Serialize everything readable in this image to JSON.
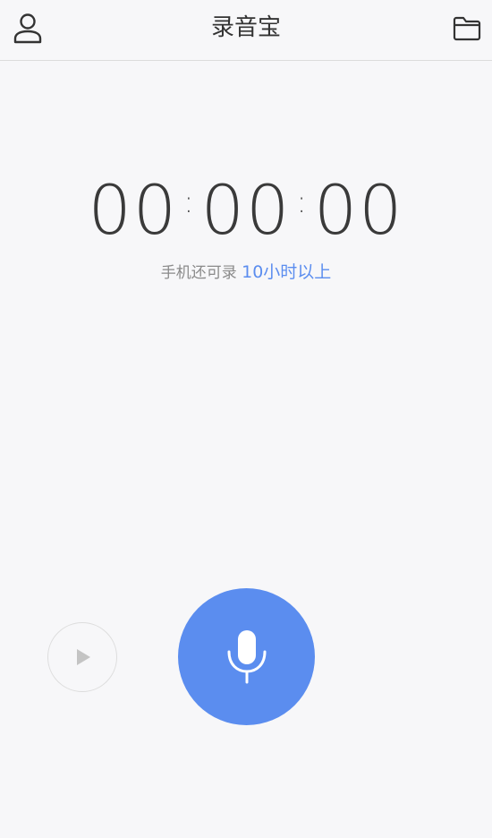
{
  "header": {
    "title": "录音宝",
    "left_icon": "user-icon",
    "right_icon": "folder-icon"
  },
  "timer": {
    "hours": "00",
    "minutes": "00",
    "seconds": "00",
    "separator": ":"
  },
  "storage": {
    "prefix": "手机还可录 ",
    "remaining": "10小时以上"
  },
  "controls": {
    "play_icon": "play-icon",
    "record_icon": "microphone-icon"
  },
  "colors": {
    "accent": "#5b8def",
    "background": "#f7f7f9",
    "text": "#333333",
    "muted": "#8a8a8a"
  }
}
